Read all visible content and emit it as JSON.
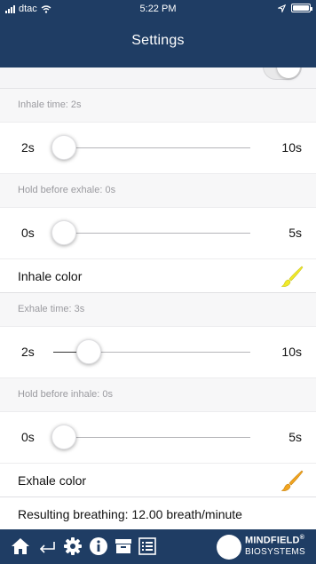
{
  "status_bar": {
    "carrier": "dtac",
    "time": "5:22 PM"
  },
  "header": {
    "title": "Settings"
  },
  "settings": {
    "inhale_time": {
      "label": "Inhale time: 2s",
      "min_label": "2s",
      "max_label": "10s",
      "value_fraction": 0.0
    },
    "hold_before_exhale": {
      "label": "Hold before exhale: 0s",
      "min_label": "0s",
      "max_label": "5s",
      "value_fraction": 0.0
    },
    "inhale_color": {
      "label": "Inhale color",
      "brush_color": "#f0ea2a"
    },
    "exhale_time": {
      "label": "Exhale time: 3s",
      "min_label": "2s",
      "max_label": "10s",
      "value_fraction": 0.125
    },
    "hold_before_inhale": {
      "label": "Hold before inhale: 0s",
      "min_label": "0s",
      "max_label": "5s",
      "value_fraction": 0.0
    },
    "exhale_color": {
      "label": "Exhale color",
      "brush_color": "#f2a51f"
    },
    "result": {
      "text": "Resulting breathing: 12.00 breath/minute"
    }
  },
  "tabbar": {
    "icons": [
      "home-icon",
      "back-icon",
      "gear-icon",
      "info-icon",
      "archive-icon",
      "list-icon"
    ],
    "logo_line1": "MINDFIELD",
    "logo_line2": "BIOSYSTEMS",
    "logo_reg": "®"
  },
  "colors": {
    "header_bg": "#1f3d64",
    "section_bg": "#f7f7f8"
  }
}
